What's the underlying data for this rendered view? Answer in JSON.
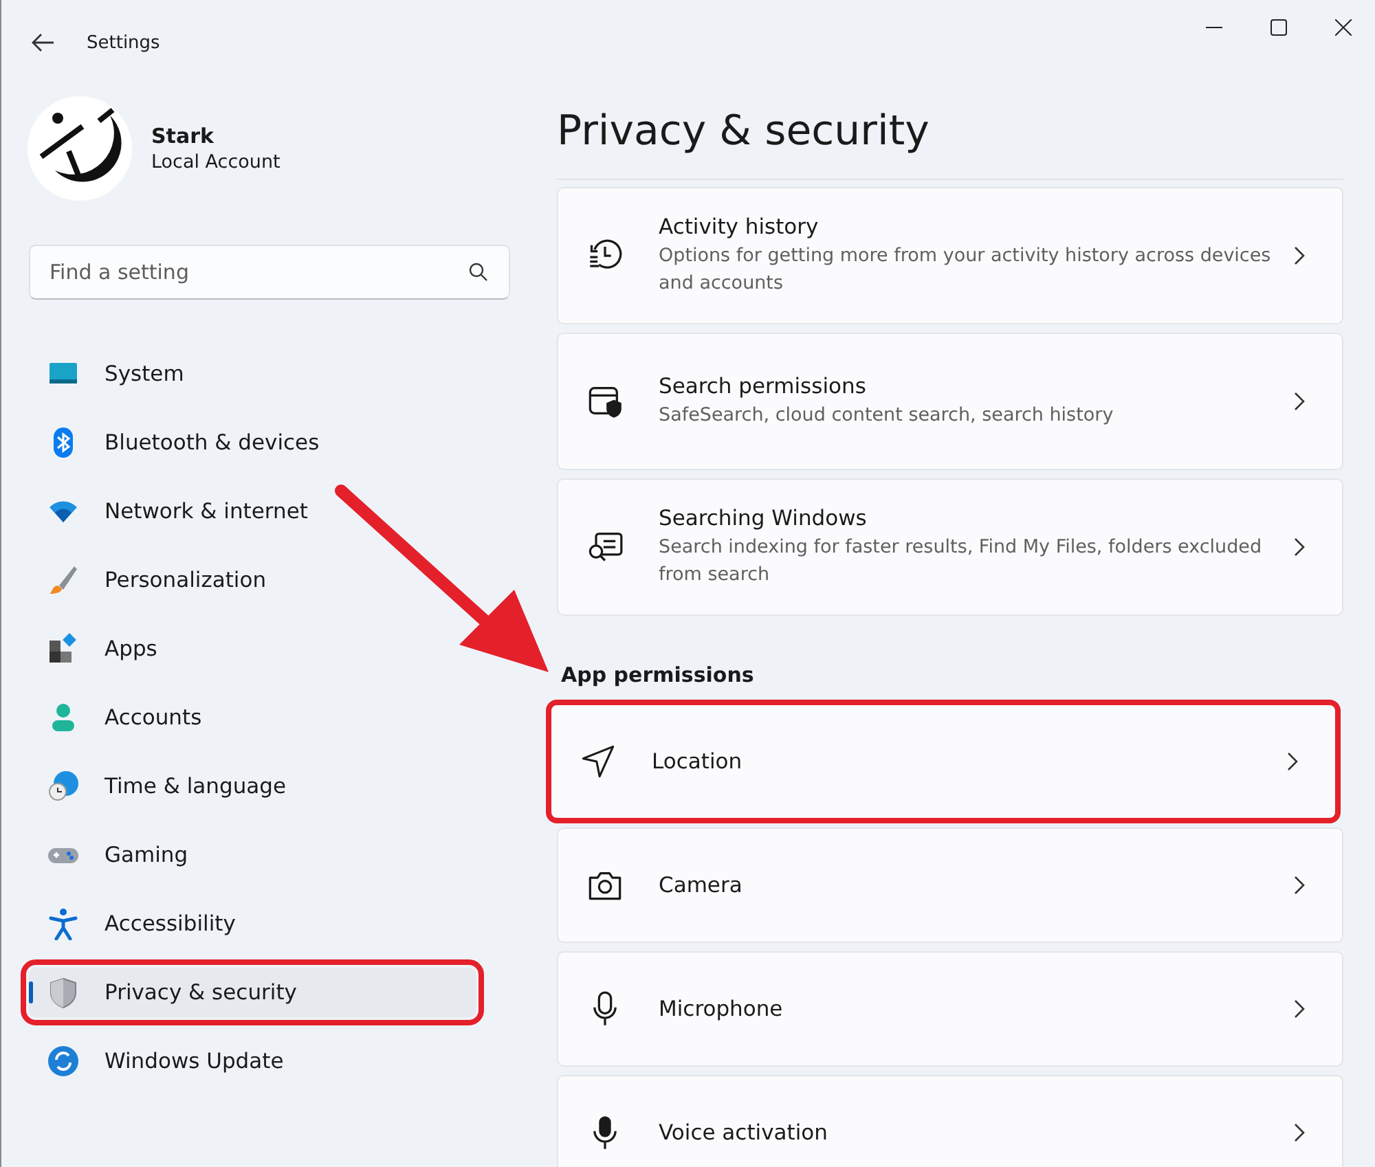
{
  "window": {
    "title": "Settings"
  },
  "account": {
    "name": "Stark",
    "type": "Local Account"
  },
  "search": {
    "placeholder": "Find a setting"
  },
  "sidebar": {
    "items": [
      {
        "label": "System",
        "selected": false,
        "highlighted": false
      },
      {
        "label": "Bluetooth & devices",
        "selected": false,
        "highlighted": false
      },
      {
        "label": "Network & internet",
        "selected": false,
        "highlighted": false
      },
      {
        "label": "Personalization",
        "selected": false,
        "highlighted": false
      },
      {
        "label": "Apps",
        "selected": false,
        "highlighted": false
      },
      {
        "label": "Accounts",
        "selected": false,
        "highlighted": false
      },
      {
        "label": "Time & language",
        "selected": false,
        "highlighted": false
      },
      {
        "label": "Gaming",
        "selected": false,
        "highlighted": false
      },
      {
        "label": "Accessibility",
        "selected": false,
        "highlighted": false
      },
      {
        "label": "Privacy & security",
        "selected": true,
        "highlighted": true
      },
      {
        "label": "Windows Update",
        "selected": false,
        "highlighted": false
      }
    ]
  },
  "page": {
    "title": "Privacy & security",
    "cards": [
      {
        "title": "Activity history",
        "description": "Options for getting more from your activity history across devices and accounts",
        "highlighted": false
      },
      {
        "title": "Search permissions",
        "description": "SafeSearch, cloud content search, search history",
        "highlighted": false
      },
      {
        "title": "Searching Windows",
        "description": "Search indexing for faster results, Find My Files, folders excluded from search",
        "highlighted": false
      }
    ],
    "section": {
      "title": "App permissions",
      "cards": [
        {
          "title": "Location",
          "highlighted": true
        },
        {
          "title": "Camera",
          "highlighted": false
        },
        {
          "title": "Microphone",
          "highlighted": false
        },
        {
          "title": "Voice activation",
          "highlighted": false
        }
      ]
    }
  }
}
